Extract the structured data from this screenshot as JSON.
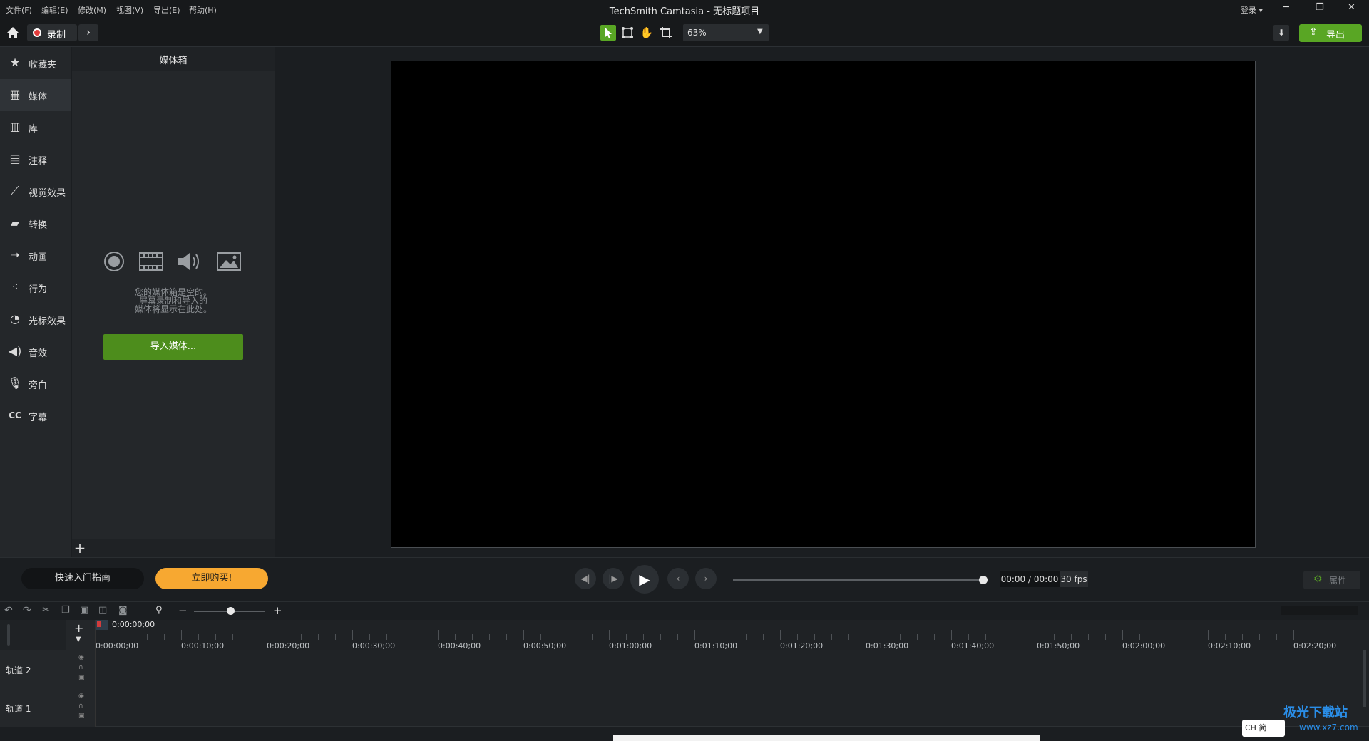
{
  "menu": [
    "文件(F)",
    "编辑(E)",
    "修改(M)",
    "视图(V)",
    "导出(E)",
    "帮助(H)"
  ],
  "app_title": "TechSmith Camtasia - 无标题项目",
  "login": "登录",
  "record_label": "录制",
  "zoom_value": "63%",
  "export_label": "导出",
  "nav": [
    {
      "label": "收藏夹",
      "icon": "star-icon"
    },
    {
      "label": "媒体",
      "icon": "film-icon"
    },
    {
      "label": "库",
      "icon": "library-icon"
    },
    {
      "label": "注释",
      "icon": "annotation-icon"
    },
    {
      "label": "视觉效果",
      "icon": "wand-icon"
    },
    {
      "label": "转换",
      "icon": "transition-icon"
    },
    {
      "label": "动画",
      "icon": "animation-icon"
    },
    {
      "label": "行为",
      "icon": "behavior-icon"
    },
    {
      "label": "光标效果",
      "icon": "cursor-icon"
    },
    {
      "label": "音效",
      "icon": "audio-icon"
    },
    {
      "label": "旁白",
      "icon": "microphone-icon"
    },
    {
      "label": "字幕",
      "icon": "cc-icon"
    }
  ],
  "mediabin": {
    "title": "媒体箱",
    "empty_line1": "您的媒体箱是空的。",
    "empty_line2": "屏幕录制和导入的",
    "empty_line3": "媒体将显示在此处。",
    "import_label": "导入媒体..."
  },
  "playbar": {
    "guide_label": "快速入门指南",
    "buy_label": "立即购买!",
    "time": "00:00 / 00:00",
    "fps": "30 fps",
    "properties": "属性"
  },
  "timeline": {
    "playhead_time": "0:00:00;00",
    "ticks": [
      "0:00:00;00",
      "0:00:10;00",
      "0:00:20;00",
      "0:00:30;00",
      "0:00:40;00",
      "0:00:50;00",
      "0:01:00;00",
      "0:01:10;00",
      "0:01:20;00",
      "0:01:30;00",
      "0:01:40;00",
      "0:01:50;00",
      "0:02:00;00",
      "0:02:10;00",
      "0:02:20;00"
    ],
    "tracks": [
      "轨道 2",
      "轨道 1"
    ]
  },
  "watermark": {
    "site": "极光下载站",
    "url": "www.xz7.com",
    "ime": "CH 简"
  }
}
